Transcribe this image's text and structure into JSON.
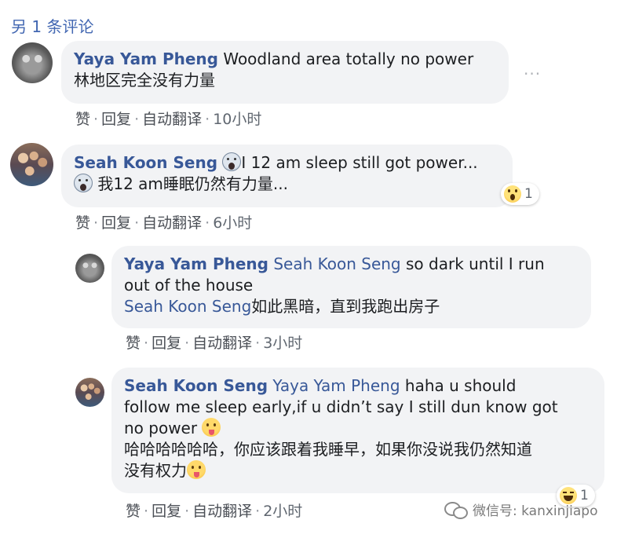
{
  "header": {
    "more_comments": "另 1 条评论"
  },
  "actions": {
    "like": "赞",
    "reply": "回复",
    "translate": "自动翻译",
    "more_dots": "···"
  },
  "comments": [
    {
      "author": "Yaya Yam Pheng",
      "text": "Woodland area totally no power",
      "translation": "林地区完全没有力量",
      "time": "10小时"
    },
    {
      "author": "Seah Koon Seng",
      "text": "I 12 am sleep still got power...",
      "translation": "我12 am睡眠仍然有力量...",
      "time": "6小时",
      "reaction": {
        "icon": "wow-reaction-icon",
        "count": "1"
      }
    }
  ],
  "replies": [
    {
      "author": "Yaya Yam Pheng",
      "mention": "Seah Koon Seng",
      "text": "so dark until I run",
      "text2": "out of the house",
      "translation_mention": "Seah Koon Seng",
      "translation": "如此黑暗，直到我跑出房子",
      "time": "3小时"
    },
    {
      "author": "Seah Koon Seng",
      "mention": "Yaya Yam Pheng",
      "text": "haha u should",
      "text2": "follow me sleep early,if u didn’t say I still dun know got",
      "text3": "no power",
      "translation": "哈哈哈哈哈哈，你应该跟着我睡早，如果你没说我仍然知道",
      "translation2": "没有权力",
      "time": "2小时",
      "reaction": {
        "icon": "haha-reaction-icon",
        "count": "1"
      }
    }
  ],
  "watermark": {
    "text": "微信号: kanxinjiapo"
  }
}
